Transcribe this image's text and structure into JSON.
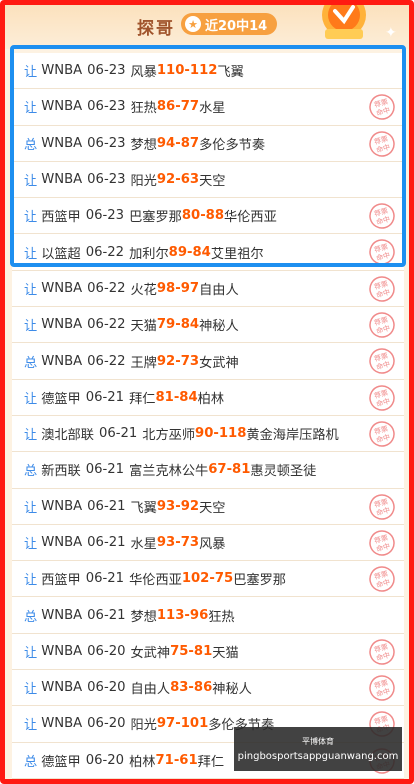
{
  "header": {
    "title": "探哥",
    "badge_text": "近20中14"
  },
  "colors": {
    "accent_red": "#ff1a12",
    "highlight_blue": "#1d8ff0",
    "score_orange": "#ff5a00",
    "tag_blue": "#3d8be8"
  },
  "stamp_text": "荐票命中",
  "rows": [
    {
      "tag": "让",
      "league": "WNBA",
      "date": "06-23",
      "home": "风暴",
      "hs": "110",
      "as": "112",
      "away": "飞翼",
      "hit": false
    },
    {
      "tag": "让",
      "league": "WNBA",
      "date": "06-23",
      "home": "狂热",
      "hs": "86",
      "as": "77",
      "away": "水星",
      "hit": true
    },
    {
      "tag": "总",
      "league": "WNBA",
      "date": "06-23",
      "home": "梦想",
      "hs": "94",
      "as": "87",
      "away": "多伦多节奏",
      "hit": true
    },
    {
      "tag": "让",
      "league": "WNBA",
      "date": "06-23",
      "home": "阳光",
      "hs": "92",
      "as": "63",
      "away": "天空",
      "hit": false
    },
    {
      "tag": "让",
      "league": "西篮甲",
      "date": "06-23",
      "home": "巴塞罗那",
      "hs": "80",
      "as": "88",
      "away": "华伦西亚",
      "hit": true
    },
    {
      "tag": "让",
      "league": "以篮超",
      "date": "06-22",
      "home": "加利尔",
      "hs": "89",
      "as": "84",
      "away": "艾里祖尔",
      "hit": true
    },
    {
      "tag": "让",
      "league": "WNBA",
      "date": "06-22",
      "home": "火花",
      "hs": "98",
      "as": "97",
      "away": "自由人",
      "hit": true
    },
    {
      "tag": "让",
      "league": "WNBA",
      "date": "06-22",
      "home": "天猫",
      "hs": "79",
      "as": "84",
      "away": "神秘人",
      "hit": true
    },
    {
      "tag": "总",
      "league": "WNBA",
      "date": "06-22",
      "home": "王牌",
      "hs": "92",
      "as": "73",
      "away": "女武神",
      "hit": true
    },
    {
      "tag": "让",
      "league": "德篮甲",
      "date": "06-21",
      "home": "拜仁",
      "hs": "81",
      "as": "84",
      "away": "柏林",
      "hit": true
    },
    {
      "tag": "让",
      "league": "澳北部联",
      "date": "06-21",
      "home": "北方巫师",
      "hs": "90",
      "as": "118",
      "away": "黄金海岸压路机",
      "hit": true
    },
    {
      "tag": "总",
      "league": "新西联",
      "date": "06-21",
      "home": "富兰克林公牛",
      "hs": "67",
      "as": "81",
      "away": "惠灵顿圣徒",
      "hit": false
    },
    {
      "tag": "让",
      "league": "WNBA",
      "date": "06-21",
      "home": "飞翼",
      "hs": "93",
      "as": "92",
      "away": "天空",
      "hit": true
    },
    {
      "tag": "让",
      "league": "WNBA",
      "date": "06-21",
      "home": "水星",
      "hs": "93",
      "as": "73",
      "away": "风暴",
      "hit": true
    },
    {
      "tag": "让",
      "league": "西篮甲",
      "date": "06-21",
      "home": "华伦西亚",
      "hs": "102",
      "as": "75",
      "away": "巴塞罗那",
      "hit": true
    },
    {
      "tag": "总",
      "league": "WNBA",
      "date": "06-21",
      "home": "梦想",
      "hs": "113",
      "as": "96",
      "away": "狂热",
      "hit": false
    },
    {
      "tag": "让",
      "league": "WNBA",
      "date": "06-20",
      "home": "女武神",
      "hs": "75",
      "as": "81",
      "away": "天猫",
      "hit": true
    },
    {
      "tag": "让",
      "league": "WNBA",
      "date": "06-20",
      "home": "自由人",
      "hs": "83",
      "as": "86",
      "away": "神秘人",
      "hit": true
    },
    {
      "tag": "让",
      "league": "WNBA",
      "date": "06-20",
      "home": "阳光",
      "hs": "97",
      "as": "101",
      "away": "多伦多节奏",
      "hit": true
    },
    {
      "tag": "总",
      "league": "德篮甲",
      "date": "06-20",
      "home": "柏林",
      "hs": "71",
      "as": "61",
      "away": "拜仁",
      "hit": true
    }
  ],
  "watermark": {
    "line1": "平博体育",
    "line2": "pingbosportsappguanwang.com"
  }
}
